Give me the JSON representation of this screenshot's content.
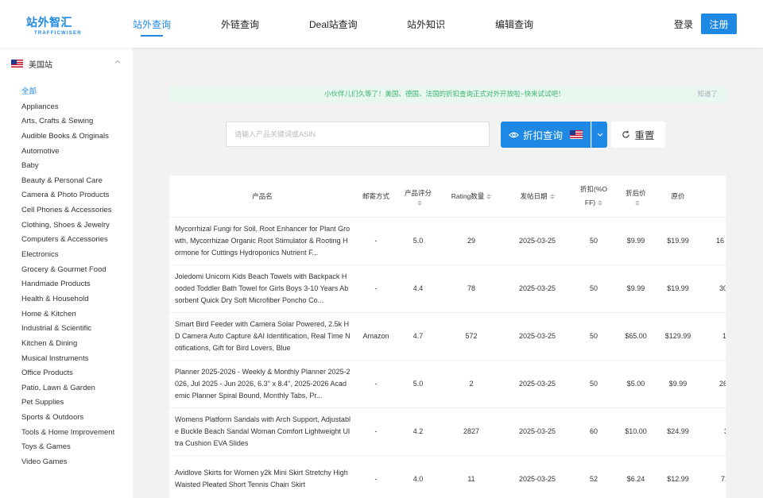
{
  "header": {
    "logo_text": "站外智汇",
    "logo_sub": "TRAFFICWISER",
    "nav": [
      {
        "label": "站外查询",
        "active": true
      },
      {
        "label": "外链查询",
        "active": false
      },
      {
        "label": "Deal站查询",
        "active": false
      },
      {
        "label": "站外知识",
        "active": false
      },
      {
        "label": "编辑查询",
        "active": false
      }
    ],
    "login_label": "登录",
    "register_label": "注册"
  },
  "sidebar": {
    "site_label": "美国站",
    "categories": [
      "全部",
      "Appliances",
      "Arts, Crafts & Sewing",
      "Audible Books & Originals",
      "Automotive",
      "Baby",
      "Beauty & Personal Care",
      "Camera & Photo Products",
      "Cell Phones & Accessories",
      "Clothing, Shoes & Jewelry",
      "Computers & Accessories",
      "Electronics",
      "Grocery & Gourmet Food",
      "Handmade Products",
      "Health & Household",
      "Home & Kitchen",
      "Industrial & Scientific",
      "Kitchen & Dining",
      "Musical Instruments",
      "Office Products",
      "Patio, Lawn & Garden",
      "Pet Supplies",
      "Sports & Outdoors",
      "Tools & Home Improvement",
      "Toys & Games",
      "Video Games"
    ]
  },
  "notice": {
    "text": "小伙伴儿们久等了！美国、德国、法国的折扣查询正式对外开放啦~快来试试吧！",
    "close_label": "知道了"
  },
  "search": {
    "placeholder": "请输入产品关键词或ASIN",
    "query_label": "折扣查询",
    "reset_label": "重置"
  },
  "table": {
    "headers": {
      "name": "产品名",
      "shipping": "邮寄方式",
      "rating_line1": "产品评分",
      "rating_count": "Rating数量",
      "post_date": "发帖日期",
      "discount_line1": "折扣(%O",
      "discount_line2": "FF)",
      "final_price": "折后价",
      "original_price": "原价"
    },
    "rows": [
      {
        "name": "Mycorrhizal Fungi for Soil, Root Enhancer for Plant Growth, Mycorrhizae Organic Root Stimulator & Rooting Hormone for Cuttings Hydroponics Nutrient F...",
        "shipping": "-",
        "rating": "5.0",
        "count": "29",
        "date": "2025-03-25",
        "discount": "50",
        "final": "$9.99",
        "original": "$19.99",
        "extra": "16"
      },
      {
        "name": "Joiedomi Unicorn Kids Beach Towels with Backpack Hooded Toddler Bath Towel for Girls Boys 3-10 Years Absorbent Quick Dry Soft Microfiber Poncho Co...",
        "shipping": "-",
        "rating": "4.4",
        "count": "78",
        "date": "2025-03-25",
        "discount": "50",
        "final": "$9.99",
        "original": "$19.99",
        "extra": "30"
      },
      {
        "name": "Smart Bird Feeder with Camera Solar Powered, 2.5k HD Camera Auto Capture &AI Identification, Real Time Notifications, Gift for Bird Lovers, Blue",
        "shipping": "Amazon",
        "rating": "4.7",
        "count": "572",
        "date": "2025-03-25",
        "discount": "50",
        "final": "$65.00",
        "original": "$129.99",
        "extra": "1"
      },
      {
        "name": "Planner 2025-2026 - Weekly & Monthly Planner 2025-2026, Jul 2025 - Jun 2026, 6.3'' x 8.4'', 2025-2026 Academic Planner Spiral Bound, Monthly Tabs, Pr...",
        "shipping": "-",
        "rating": "5.0",
        "count": "2",
        "date": "2025-03-25",
        "discount": "50",
        "final": "$5.00",
        "original": "$9.99",
        "extra": "26"
      },
      {
        "name": "Womens Platform Sandals with Arch Support, Adjustable Buckle Beach Sandal Woman Comfort Lightweight Ultra Cushion EVA Slides",
        "shipping": "-",
        "rating": "4.2",
        "count": "2827",
        "date": "2025-03-25",
        "discount": "60",
        "final": "$10.00",
        "original": "$24.99",
        "extra": "3"
      },
      {
        "name": "Avidlove Skirts for Women y2k Mini Skirt Stretchy High Waisted Pleated Short Tennis Chain Skirt",
        "shipping": "-",
        "rating": "4.0",
        "count": "11",
        "date": "2025-03-25",
        "discount": "52",
        "final": "$6.24",
        "original": "$12.99",
        "extra": "71"
      }
    ]
  }
}
